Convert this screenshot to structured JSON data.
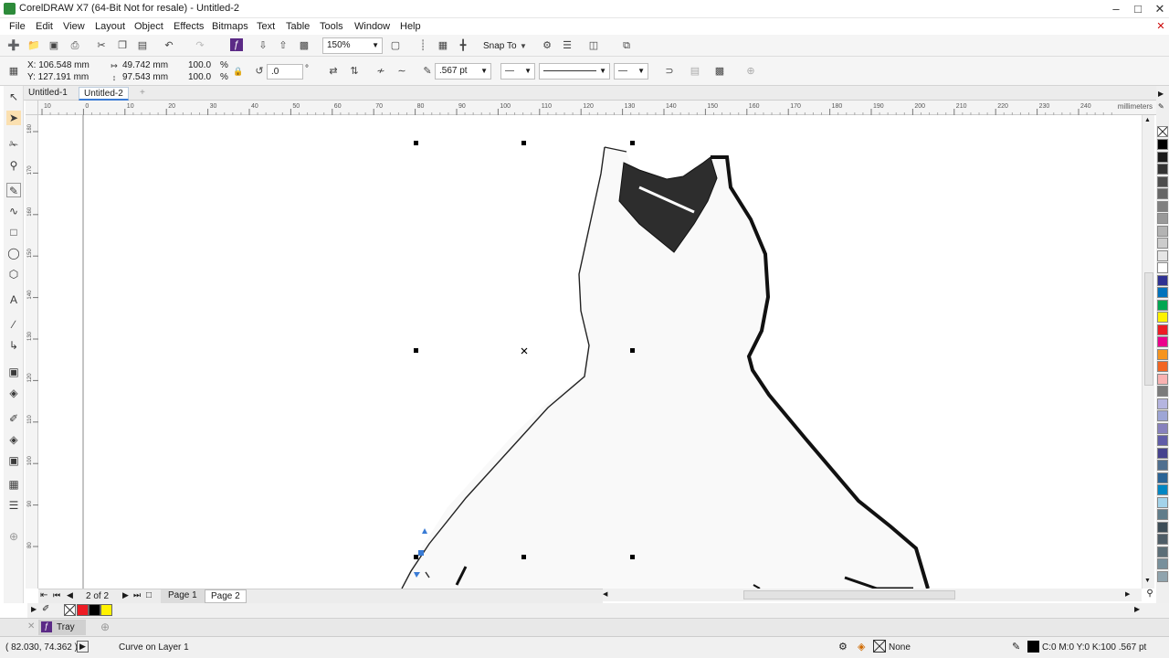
{
  "app": {
    "title": "CorelDRAW X7 (64-Bit Not for resale) - Untitled-2"
  },
  "menu": [
    "File",
    "Edit",
    "View",
    "Layout",
    "Object",
    "Effects",
    "Bitmaps",
    "Text",
    "Table",
    "Tools",
    "Window",
    "Help"
  ],
  "standard_toolbar": {
    "zoom_level": "150%",
    "snap_to": "Snap To"
  },
  "property_bar": {
    "x": "X: 106.548 mm",
    "y": "Y: 127.191 mm",
    "width": "49.742 mm",
    "height": "97.543 mm",
    "scale_w": "100.0",
    "scale_h": "100.0",
    "pct": "%",
    "pct2": "%",
    "rotation": ".0",
    "degree": "°",
    "outline_width": ".567 pt"
  },
  "doc_tabs": [
    "Untitled-1",
    "Untitled-2"
  ],
  "active_tab": "Untitled-2",
  "ruler": {
    "h_ticks": [
      "10",
      "0",
      "10",
      "20",
      "30",
      "40",
      "50",
      "60",
      "70",
      "80",
      "90",
      "100",
      "110",
      "120",
      "130",
      "140",
      "150",
      "160",
      "170",
      "180",
      "190",
      "200",
      "210",
      "220",
      "230",
      "240"
    ],
    "units": "millimeters",
    "v_ticks": [
      "180",
      "170",
      "160",
      "150",
      "140",
      "130",
      "120",
      "110",
      "100",
      "90",
      "80"
    ]
  },
  "page_nav": {
    "counter": "2 of 2",
    "pages": [
      "Page 1",
      "Page 2"
    ]
  },
  "tray": {
    "label": "Tray"
  },
  "status": {
    "coords": "( 82.030, 74.362 )",
    "object": "Curve on Layer 1",
    "fill": "None",
    "outline": "C:0 M:0 Y:0 K:100  .567 pt"
  },
  "palette_colors": [
    "#000000",
    "#1a1a1a",
    "#333333",
    "#4d4d4d",
    "#666666",
    "#808080",
    "#999999",
    "#b3b3b3",
    "#cccccc",
    "#e6e6e6",
    "#ffffff",
    "#2e3192",
    "#0072bc",
    "#00a651",
    "#fff200",
    "#ed1c24",
    "#ec008c",
    "#f7941d",
    "#f26522",
    "#f9b2b1",
    "#7b7b7b",
    "#b5b5e0",
    "#9ea6d6",
    "#8781bd",
    "#605ca8",
    "#45428e",
    "#4f6f8f",
    "#2a6496",
    "#0086c3",
    "#a3d3ea",
    "#607d8b",
    "#3d4d57",
    "#4e5d67",
    "#5c6e77",
    "#78909c",
    "#90a4ae"
  ],
  "document_palette": [
    "#ed1c24",
    "#000000",
    "#fff200"
  ]
}
